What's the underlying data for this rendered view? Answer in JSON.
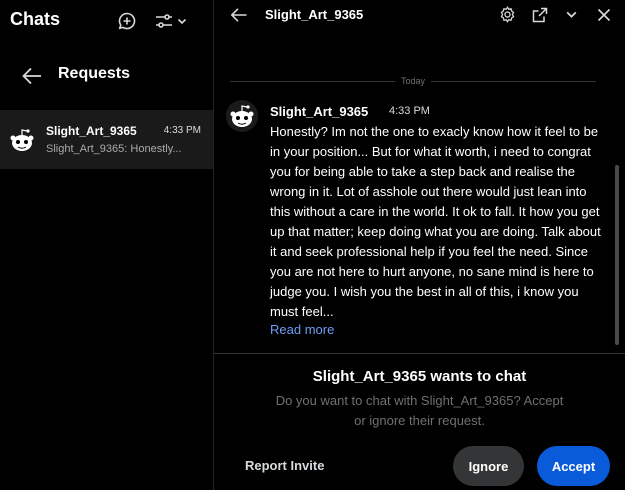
{
  "left": {
    "title": "Chats",
    "new_chat_icon": "chat-plus-icon",
    "filter_icon": "filter-icon",
    "filter_chevron_icon": "chevron-down-icon",
    "requests_label": "Requests",
    "back_icon": "arrow-left-icon",
    "requests": [
      {
        "name": "Slight_Art_9365",
        "time": "4:33 PM",
        "preview": "Slight_Art_9365: Honestly..."
      }
    ]
  },
  "chat": {
    "back_icon": "arrow-left-icon",
    "username": "Slight_Art_9365",
    "top_icons": [
      "settings-icon",
      "open-external-icon",
      "chevron-down-icon",
      "close-icon"
    ],
    "day_label": "Today",
    "message": {
      "author": "Slight_Art_9365",
      "time": "4:33 PM",
      "body": "Honestly? Im not the one to exacly know how it feel to be in your position... But for what it worth, i need to congrat you for being able to take a step back and realise the wrong in it. Lot of asshole out there would just lean into this without a care in the world. It ok to fall. It how you get up that matter; keep doing what you are doing. Talk about it and seek professional help if you feel the need. Since you are not here to hurt anyone, no sane mind is here to judge you. I wish you the best in all of this, i know you must feel...",
      "read_more": "Read more"
    },
    "request_panel": {
      "title": "Slight_Art_9365 wants to chat",
      "subtitle": "Do you want to chat with Slight_Art_9365? Accept or ignore their request.",
      "report_label": "Report Invite",
      "ignore_label": "Ignore",
      "accept_label": "Accept"
    }
  },
  "colors": {
    "background": "#000000",
    "accent": "#0a5bd9",
    "link": "#6d9ff6",
    "selected_row": "#1a1a1b"
  }
}
